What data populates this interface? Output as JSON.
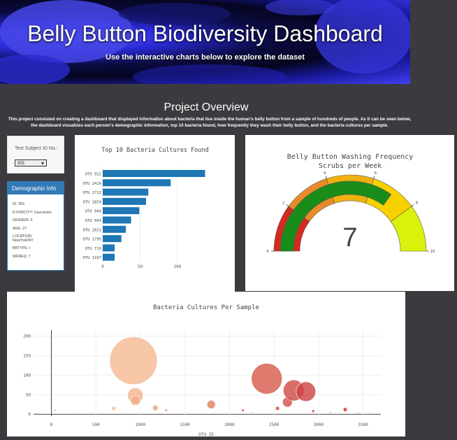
{
  "header": {
    "title": "Belly Button Biodiversity Dashboard",
    "subtitle": "Use the interactive charts below to explore the dataset"
  },
  "overview": {
    "title": "Project Overview",
    "text": "This project consisted on creating a dashboard that displayed information about bacteria that live inside the human's belly button from a sample of hundreds of people. As it can be seen below, the dashboard visualizes each person's demographic information, top 10 bacteria found, how frequently they wash their belly button, and the bacteria cultures per sample."
  },
  "selector": {
    "label": "Test Subject ID No.:",
    "value": "955"
  },
  "demographic": {
    "title": "Demographic Info",
    "rows": [
      "ID: 955",
      "ETHNICITY: Caucasian",
      "GENDER: F",
      "AGE: 27",
      "LOCATION: NewYork/NY",
      "BBTYPE: I",
      "WFREQ: 7"
    ]
  },
  "colors": {
    "bar": "#1f77b4",
    "page_bg": "#3b3b3f",
    "panel_head": "#337ab7"
  },
  "chart_data": [
    {
      "type": "bar",
      "orientation": "horizontal",
      "title": "Top 10 Bacteria Cultures Found",
      "categories": [
        "OTU 922",
        "OTU 2419",
        "OTU 2722",
        "OTU 2859",
        "OTU 944",
        "OTU 943",
        "OTU 2651",
        "OTU 1795",
        "OTU 719",
        "OTU 1167"
      ],
      "values": [
        137,
        91,
        61,
        58,
        49,
        38,
        31,
        25,
        16,
        16
      ],
      "xlim": [
        0,
        145
      ],
      "xticks": [
        0,
        50,
        100
      ]
    },
    {
      "type": "gauge",
      "title": "Belly Button Washing Frequency",
      "subtitle": "Scrubs per Week",
      "value": 7,
      "range": [
        0,
        10
      ],
      "ticks": [
        "0",
        "2",
        "4",
        "6",
        "8",
        "10"
      ],
      "bands": [
        {
          "from": 0,
          "to": 2,
          "color": "#d62a1e"
        },
        {
          "from": 2,
          "to": 4,
          "color": "#e98b2a"
        },
        {
          "from": 4,
          "to": 6,
          "color": "#f0b00f"
        },
        {
          "from": 6,
          "to": 8,
          "color": "#f7d000"
        },
        {
          "from": 8,
          "to": 10,
          "color": "#dbf00a"
        }
      ],
      "bar_color": "#1a8c1a"
    },
    {
      "type": "scatter",
      "title": "Bacteria Cultures Per Sample",
      "xlabel": "OTU ID",
      "xlim": [
        -200,
        3700
      ],
      "ylim": [
        -5,
        215
      ],
      "xticks": [
        0,
        500,
        1000,
        1500,
        2000,
        2500,
        3000,
        3500
      ],
      "yticks": [
        0,
        50,
        100,
        150,
        200
      ],
      "points": [
        {
          "x": 40,
          "y": 10,
          "s": 2,
          "c": "#f2c9b6"
        },
        {
          "x": 290,
          "y": 3,
          "s": 1,
          "c": "#f0c6b0"
        },
        {
          "x": 700,
          "y": 15,
          "s": 3,
          "c": "#f6bd98"
        },
        {
          "x": 830,
          "y": 3,
          "s": 1,
          "c": "#f4c09d"
        },
        {
          "x": 922,
          "y": 137,
          "s": 34,
          "c": "#f4b891"
        },
        {
          "x": 943,
          "y": 48,
          "s": 11,
          "c": "#f3b48c"
        },
        {
          "x": 944,
          "y": 35,
          "s": 7,
          "c": "#f1ad86"
        },
        {
          "x": 1167,
          "y": 16,
          "s": 4,
          "c": "#eea37c"
        },
        {
          "x": 1290,
          "y": 10,
          "s": 2,
          "c": "#ec9a74"
        },
        {
          "x": 1795,
          "y": 25,
          "s": 6,
          "c": "#e4805f"
        },
        {
          "x": 2150,
          "y": 10,
          "s": 2,
          "c": "#dc6a54"
        },
        {
          "x": 2260,
          "y": 5,
          "s": 1,
          "c": "#d9624f"
        },
        {
          "x": 2419,
          "y": 91,
          "s": 22,
          "c": "#d6594a"
        },
        {
          "x": 2540,
          "y": 15,
          "s": 3,
          "c": "#d65649"
        },
        {
          "x": 2651,
          "y": 31,
          "s": 7,
          "c": "#d24d45"
        },
        {
          "x": 2722,
          "y": 61,
          "s": 15,
          "c": "#d04843"
        },
        {
          "x": 2859,
          "y": 58,
          "s": 14,
          "c": "#cd4242"
        },
        {
          "x": 2940,
          "y": 8,
          "s": 2,
          "c": "#cc3f40"
        },
        {
          "x": 3130,
          "y": 5,
          "s": 1,
          "c": "#c93a3d"
        },
        {
          "x": 3300,
          "y": 12,
          "s": 3,
          "c": "#c7363b"
        },
        {
          "x": 3450,
          "y": 3,
          "s": 1,
          "c": "#c5323a"
        },
        {
          "x": 3560,
          "y": 2,
          "s": 1,
          "c": "#c32f38"
        }
      ]
    }
  ]
}
